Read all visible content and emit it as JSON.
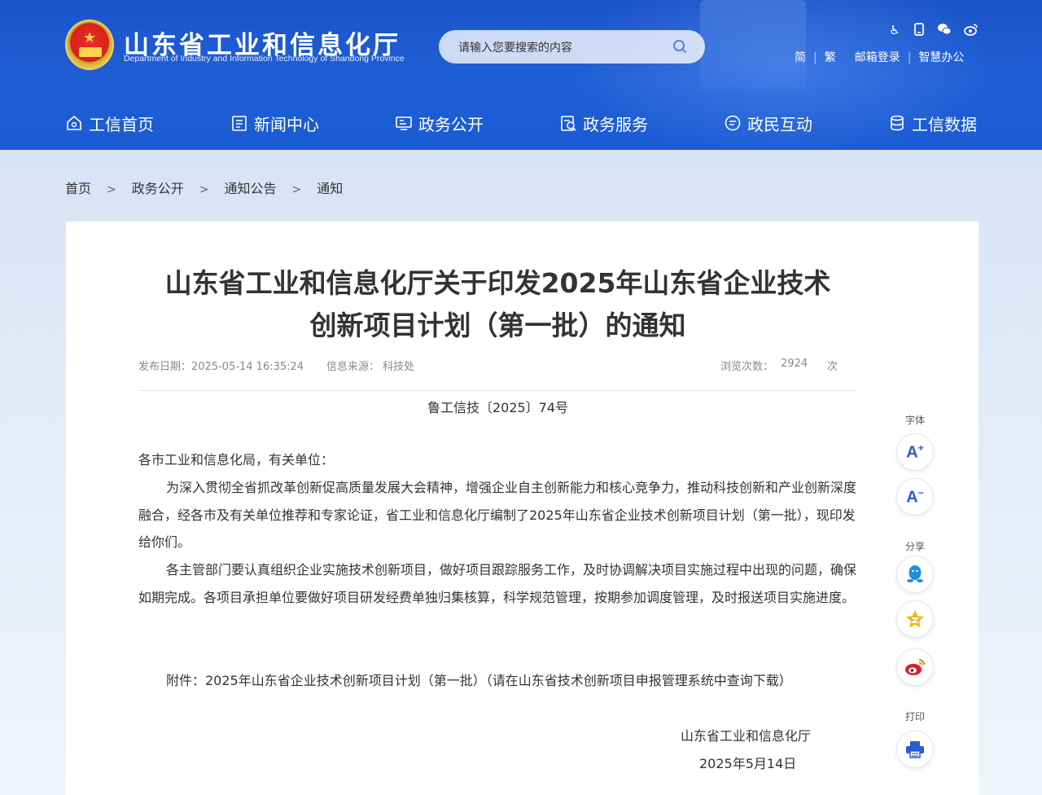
{
  "header": {
    "title": "山东省工业和信息化厅",
    "subtitle": "Department of Industry and Information Technology of Shandong Province",
    "search_placeholder": "请输入您要搜索的内容",
    "util_icons": [
      "accessibility-icon",
      "mobile-icon",
      "wechat-icon",
      "weibo-icon"
    ],
    "util_links": [
      "简",
      "繁",
      "邮箱登录",
      "智慧办公"
    ]
  },
  "nav": [
    {
      "label": "工信首页",
      "icon": "home-icon"
    },
    {
      "label": "新闻中心",
      "icon": "news-icon"
    },
    {
      "label": "政务公开",
      "icon": "monitor-icon"
    },
    {
      "label": "政务服务",
      "icon": "service-icon"
    },
    {
      "label": "政民互动",
      "icon": "chat-icon"
    },
    {
      "label": "工信数据",
      "icon": "database-icon"
    }
  ],
  "breadcrumb": [
    "首页",
    "政务公开",
    "通知公告",
    "通知"
  ],
  "breadcrumb_sep": ">",
  "article": {
    "title_line1": "山东省工业和信息化厅关于印发2025年山东省企业技术",
    "title_line2": "创新项目计划（第一批）的通知",
    "publish_date": "发布日期：2025-05-14 16:35:24",
    "source": "信息来源：  科技处",
    "views_label": "浏览次数：",
    "views": "2924",
    "views_unit": "次",
    "doc_number": "鲁工信技〔2025〕74号",
    "salutation": "各市工业和信息化局，有关单位：",
    "para1": "为深入贯彻全省抓改革创新促高质量发展大会精神，增强企业自主创新能力和核心竞争力，推动科技创新和产业创新深度融合，经各市及有关单位推荐和专家论证，省工业和信息化厅编制了2025年山东省企业技术创新项目计划（第一批），现印发给你们。",
    "para2": "各主管部门要认真组织企业实施技术创新项目，做好项目跟踪服务工作，及时协调解决项目实施过程中出现的问题，确保如期完成。各项目承担单位要做好项目研发经费单独归集核算，科学规范管理，按期参加调度管理，及时报送项目实施进度。",
    "attachment": "附件：2025年山东省企业技术创新项目计划（第一批）（请在山东省技术创新项目申报管理系统中查询下载）",
    "signature": "山东省工业和信息化厅",
    "sign_date": "2025年5月14日"
  },
  "side_tools": {
    "font_label": "字体",
    "font_increase": "A",
    "font_decrease": "A",
    "share_label": "分享",
    "share_icons": [
      "qq-icon",
      "qzone-icon",
      "weibo-icon"
    ],
    "print_label": "打印",
    "colors": {
      "qq": "#1e8fe0",
      "qzone": "#f5b400",
      "weibo": "#e6162d",
      "accent": "#2a5bd0"
    }
  }
}
